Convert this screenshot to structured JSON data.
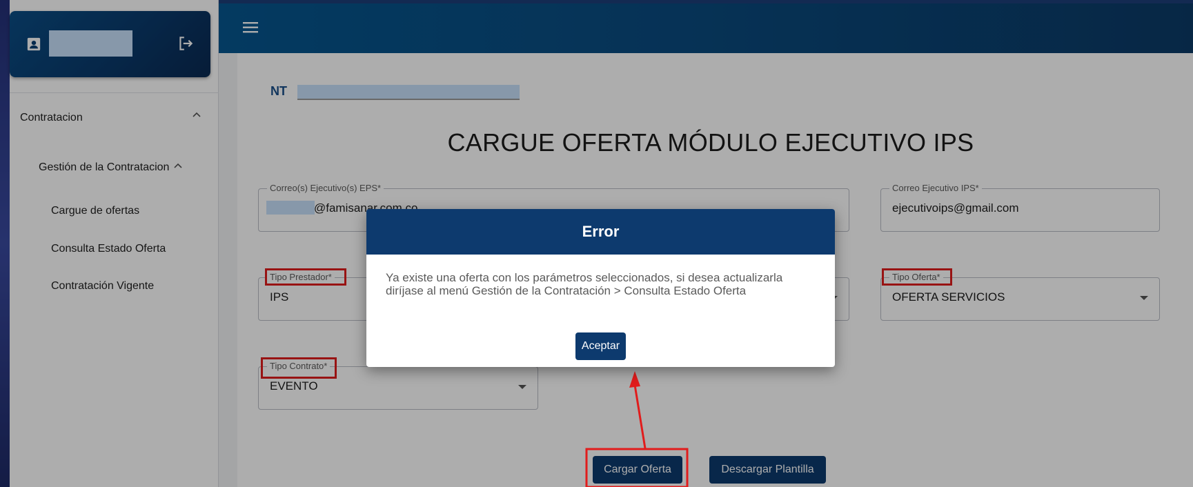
{
  "sidebar": {
    "items": [
      {
        "label": "Contratacion"
      },
      {
        "label": "Gestión de la Contratacion"
      },
      {
        "label": "Cargue de ofertas"
      },
      {
        "label": "Consulta Estado Oferta"
      },
      {
        "label": "Contratación Vigente"
      }
    ]
  },
  "header": {
    "nt_label": "NT",
    "title": "CARGUE OFERTA MÓDULO EJECUTIVO IPS"
  },
  "form": {
    "correo_eps": {
      "label": "Correo(s) Ejecutivo(s) EPS*",
      "value": "@famisanar.com.co"
    },
    "correo_ips": {
      "label": "Correo Ejecutivo IPS*",
      "value": "ejecutivoips@gmail.com"
    },
    "tipo_prestador": {
      "label": "Tipo Prestador*",
      "value": "IPS"
    },
    "tipo_oferta": {
      "label": "Tipo Oferta*",
      "value": "OFERTA SERVICIOS"
    },
    "tipo_contrato": {
      "label": "Tipo Contrato*",
      "value": "EVENTO"
    }
  },
  "actions": {
    "cargar": "Cargar Oferta",
    "descargar": "Descargar Plantilla"
  },
  "dialog": {
    "title": "Error",
    "line1": "Ya existe una oferta con los parámetros seleccionados, si desea actualizarla",
    "line2": "diríjase al menú Gestión de la Contratación > Consulta Estado Oferta",
    "button": "Aceptar"
  },
  "colors": {
    "primary": "#0d3a6e",
    "annotation": "#e11c1c"
  }
}
